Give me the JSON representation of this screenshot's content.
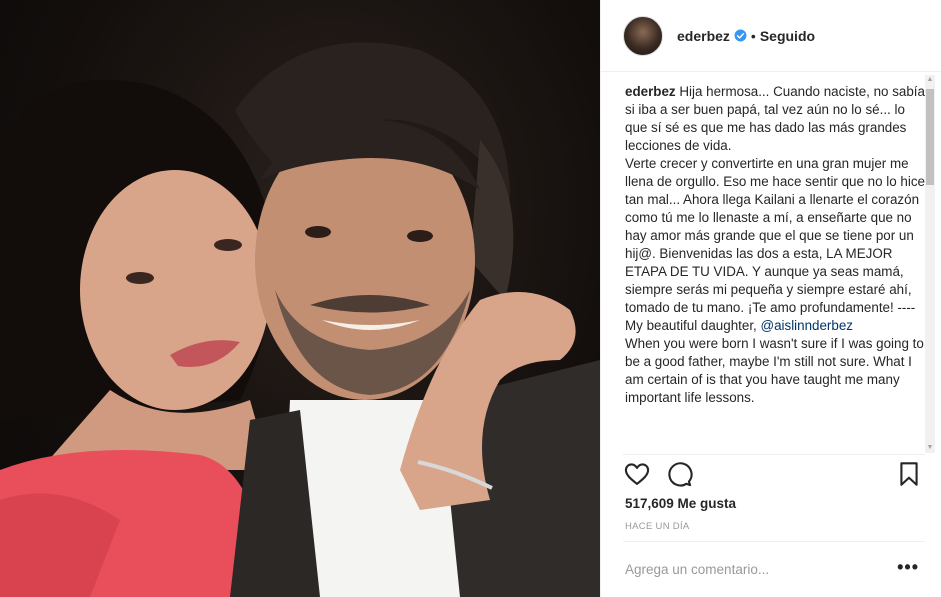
{
  "post": {
    "photo_icon": "photo",
    "header": {
      "username": "ederbez",
      "verified_icon": "verified-badge-icon",
      "separator": "•",
      "follow_status": "Seguido"
    },
    "caption": {
      "username": "ederbez",
      "text_part1": " Hija hermosa... Cuando naciste, no sabía si iba a ser buen papá, tal vez aún no lo sé... lo que sí sé es que me has dado las más grandes lecciones de vida.\nVerte crecer y convertirte en una gran mujer me llena de orgullo. Eso me hace sentir que no lo hice tan mal... Ahora llega Kailani a llenarte el corazón como tú me lo llenaste a mí, a enseñarte que no hay amor más grande que el que se tiene por un hij@. Bienvenidas las dos a esta, LA MEJOR ETAPA DE TU VIDA. Y aunque ya seas mamá, siempre serás mi pequeña y siempre estaré ahí, tomado de tu mano. ¡Te amo profundamente! ---- My beautiful daughter, ",
      "mention": "@aislinnderbez",
      "text_part2": "\nWhen you were born I wasn't sure if I was going to be a good father, maybe I'm still not sure. What I am certain of is that you have taught me many important life lessons."
    },
    "actions": {
      "like_icon": "heart-icon",
      "comment_icon": "comment-icon",
      "save_icon": "bookmark-icon"
    },
    "likes_text": "517,609 Me gusta",
    "timestamp": "Hace un día",
    "comment": {
      "placeholder": "Agrega un comentario...",
      "more_label": "•••"
    },
    "colors": {
      "text": "#262626",
      "muted": "#999999",
      "link": "#003569",
      "verified": "#3897f0",
      "border": "#efefef"
    }
  }
}
